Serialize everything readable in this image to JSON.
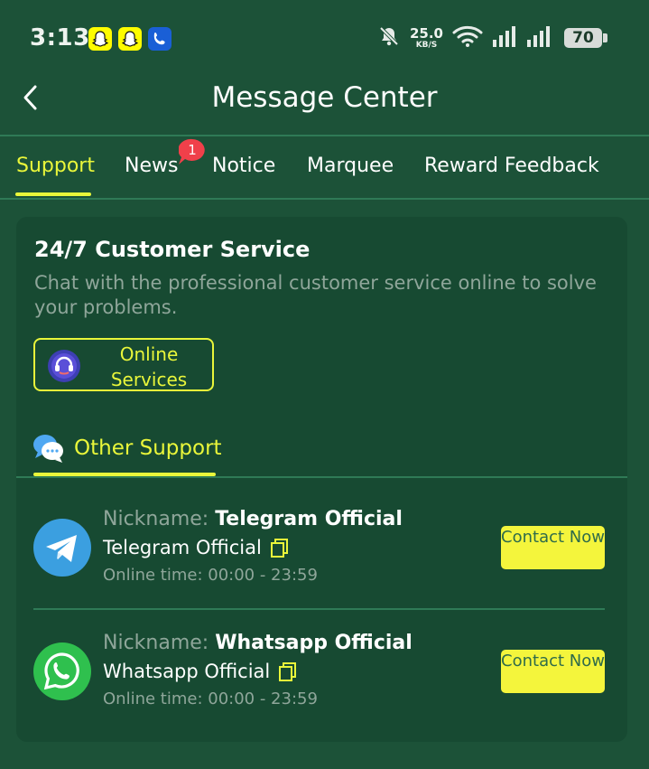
{
  "status_bar": {
    "time": "3:13",
    "net_speed_value": "25.0",
    "net_speed_unit": "KB/S",
    "battery": "70",
    "icons": [
      "snapchat-icon",
      "snapchat-icon",
      "phone-app-icon",
      "bell-off-icon",
      "wifi-icon",
      "signal-icon",
      "signal-icon"
    ]
  },
  "header": {
    "title": "Message Center",
    "back_icon": "chevron-left-icon"
  },
  "tabs": [
    {
      "label": "Support",
      "active": true
    },
    {
      "label": "News",
      "badge": "1"
    },
    {
      "label": "Notice"
    },
    {
      "label": "Marquee"
    },
    {
      "label": "Reward Feedback"
    }
  ],
  "customer_service": {
    "title": "24/7 Customer Service",
    "description": "Chat with the professional customer service online to solve your problems.",
    "online_button_label": "Online Services",
    "online_button_icon": "headset-icon"
  },
  "other_support": {
    "label": "Other Support",
    "icon": "chat-bubbles-icon"
  },
  "contacts": [
    {
      "nickname_label": "Nickname:",
      "nickname": "Telegram Official",
      "name": "Telegram Official",
      "online_time": "Online time:  00:00 - 23:59",
      "button": "Contact Now",
      "icon": "telegram-icon"
    },
    {
      "nickname_label": "Nickname:",
      "nickname": "Whatsapp Official",
      "name": "Whatsapp Official",
      "online_time": "Online time:  00:00 - 23:59",
      "button": "Contact Now",
      "icon": "whatsapp-icon"
    }
  ],
  "colors": {
    "background": "#1c5238",
    "card": "#174a32",
    "accent": "#e9f63a",
    "button": "#f4f53c",
    "muted_text": "#8fa69a",
    "badge": "#f0404a"
  }
}
